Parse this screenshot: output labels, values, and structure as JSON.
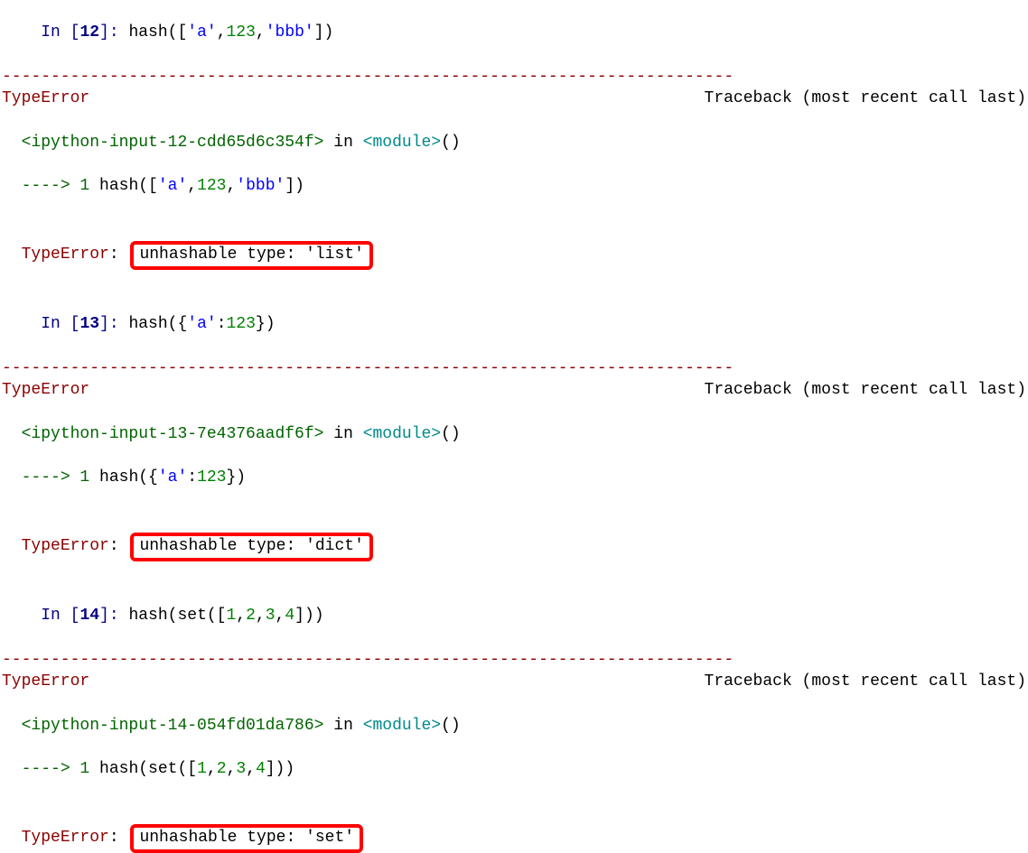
{
  "cells": [
    {
      "in_label": "In [",
      "in_num": "12",
      "in_close": "]:",
      "code_prefix": " hash([",
      "code_parts": [
        "'a'",
        ",",
        "123",
        ",",
        "'bbb'",
        "])"
      ],
      "divider": "---------------------------------------------------------------------------",
      "err_name": "TypeError",
      "traceback_label": "Traceback (most recent call last)",
      "src_ref": "<ipython-input-12-cdd65d6c354f>",
      "in_word": " in ",
      "module_ref": "<module>",
      "paren": "()",
      "arrow": "----> 1",
      "echo_prefix": " hash([",
      "echo_parts": [
        "'a'",
        ",",
        "123",
        ",",
        "'bbb'",
        "])"
      ],
      "err_line_name": "TypeError",
      "err_colon": ": ",
      "err_msg": "unhashable type: 'list'"
    },
    {
      "in_label": "In [",
      "in_num": "13",
      "in_close": "]:",
      "code_prefix": " hash({",
      "code_parts": [
        "'a'",
        ":",
        "123",
        "})"
      ],
      "divider": "---------------------------------------------------------------------------",
      "err_name": "TypeError",
      "traceback_label": "Traceback (most recent call last)",
      "src_ref": "<ipython-input-13-7e4376aadf6f>",
      "in_word": " in ",
      "module_ref": "<module>",
      "paren": "()",
      "arrow": "----> 1",
      "echo_prefix": " hash({",
      "echo_parts": [
        "'a'",
        ":",
        "123",
        "})"
      ],
      "err_line_name": "TypeError",
      "err_colon": ": ",
      "err_msg": "unhashable type: 'dict'"
    },
    {
      "in_label": "In [",
      "in_num": "14",
      "in_close": "]:",
      "code_prefix": " hash(set([",
      "code_parts": [
        "1",
        ",",
        "2",
        ",",
        "3",
        ",",
        "4",
        "]))"
      ],
      "divider": "---------------------------------------------------------------------------",
      "err_name": "TypeError",
      "traceback_label": "Traceback (most recent call last)",
      "src_ref": "<ipython-input-14-054fd01da786>",
      "in_word": " in ",
      "module_ref": "<module>",
      "paren": "()",
      "arrow": "----> 1",
      "echo_prefix": " hash(set([",
      "echo_parts": [
        "1",
        ",",
        "2",
        ",",
        "3",
        ",",
        "4",
        "]))"
      ],
      "err_line_name": "TypeError",
      "err_colon": ": ",
      "err_msg": "unhashable type: 'set'"
    }
  ]
}
